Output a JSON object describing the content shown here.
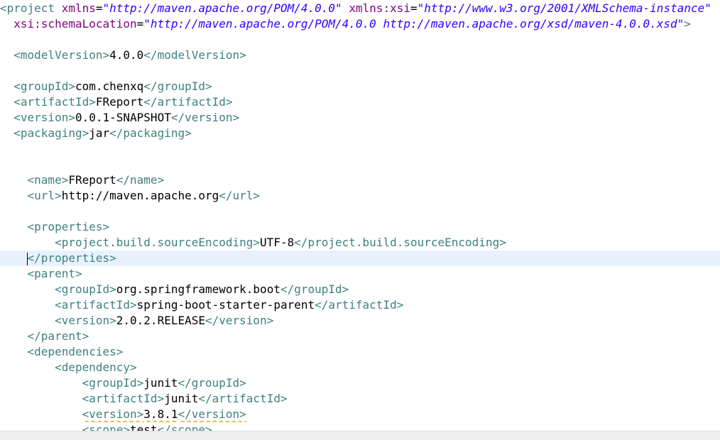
{
  "editor": {
    "lines": [
      {
        "segments": [
          {
            "t": "tag",
            "s": "<project"
          },
          {
            "t": "text",
            "s": " "
          },
          {
            "t": "attr",
            "s": "xmlns"
          },
          {
            "t": "text",
            "s": "="
          },
          {
            "t": "val",
            "s": "\"http://maven.apache.org/POM/4.0.0\""
          },
          {
            "t": "text",
            "s": " "
          },
          {
            "t": "attr",
            "s": "xmlns:xsi"
          },
          {
            "t": "text",
            "s": "="
          },
          {
            "t": "val",
            "s": "\"http://www.w3.org/2001/XMLSchema-instance\""
          }
        ]
      },
      {
        "segments": [
          {
            "t": "text",
            "s": "  "
          },
          {
            "t": "attr",
            "s": "xsi:schemaLocation"
          },
          {
            "t": "text",
            "s": "="
          },
          {
            "t": "val",
            "s": "\"http://maven.apache.org/POM/4.0.0 http://maven.apache.org/xsd/maven-4.0.0.xsd\""
          },
          {
            "t": "tag",
            "s": ">"
          }
        ]
      },
      {
        "segments": []
      },
      {
        "segments": [
          {
            "t": "text",
            "s": "  "
          },
          {
            "t": "tag",
            "s": "<modelVersion>"
          },
          {
            "t": "text",
            "s": "4.0.0"
          },
          {
            "t": "tag",
            "s": "</modelVersion>"
          }
        ]
      },
      {
        "segments": []
      },
      {
        "segments": [
          {
            "t": "text",
            "s": "  "
          },
          {
            "t": "tag",
            "s": "<groupId>"
          },
          {
            "t": "text",
            "s": "com.chenxq"
          },
          {
            "t": "tag",
            "s": "</groupId>"
          }
        ]
      },
      {
        "segments": [
          {
            "t": "text",
            "s": "  "
          },
          {
            "t": "tag",
            "s": "<artifactId>"
          },
          {
            "t": "text",
            "s": "FReport"
          },
          {
            "t": "tag",
            "s": "</artifactId>"
          }
        ]
      },
      {
        "segments": [
          {
            "t": "text",
            "s": "  "
          },
          {
            "t": "tag",
            "s": "<version>"
          },
          {
            "t": "text",
            "s": "0.0.1-SNAPSHOT"
          },
          {
            "t": "tag",
            "s": "</version>"
          }
        ]
      },
      {
        "segments": [
          {
            "t": "text",
            "s": "  "
          },
          {
            "t": "tag",
            "s": "<packaging>"
          },
          {
            "t": "text",
            "s": "jar"
          },
          {
            "t": "tag",
            "s": "</packaging>"
          }
        ]
      },
      {
        "segments": []
      },
      {
        "segments": []
      },
      {
        "segments": [
          {
            "t": "text",
            "s": "    "
          },
          {
            "t": "tag",
            "s": "<name>"
          },
          {
            "t": "text",
            "s": "FReport"
          },
          {
            "t": "tag",
            "s": "</name>"
          }
        ]
      },
      {
        "segments": [
          {
            "t": "text",
            "s": "    "
          },
          {
            "t": "tag",
            "s": "<url>"
          },
          {
            "t": "text",
            "s": "http://maven.apache.org"
          },
          {
            "t": "tag",
            "s": "</url>"
          }
        ]
      },
      {
        "segments": []
      },
      {
        "segments": [
          {
            "t": "text",
            "s": "    "
          },
          {
            "t": "tag",
            "s": "<properties>"
          }
        ]
      },
      {
        "segments": [
          {
            "t": "text",
            "s": "        "
          },
          {
            "t": "tag",
            "s": "<project.build.sourceEncoding>"
          },
          {
            "t": "text",
            "s": "UTF-8"
          },
          {
            "t": "tag",
            "s": "</project.build.sourceEncoding>"
          }
        ]
      },
      {
        "current": true,
        "caret_before": 1,
        "segments": [
          {
            "t": "text",
            "s": "    "
          },
          {
            "t": "tag",
            "s": "</properties>"
          }
        ]
      },
      {
        "segments": [
          {
            "t": "text",
            "s": "    "
          },
          {
            "t": "tag",
            "s": "<parent>"
          }
        ]
      },
      {
        "segments": [
          {
            "t": "text",
            "s": "        "
          },
          {
            "t": "tag",
            "s": "<groupId>"
          },
          {
            "t": "text",
            "s": "org.springframework.boot"
          },
          {
            "t": "tag",
            "s": "</groupId>"
          }
        ]
      },
      {
        "segments": [
          {
            "t": "text",
            "s": "        "
          },
          {
            "t": "tag",
            "s": "<artifactId>"
          },
          {
            "t": "text",
            "s": "spring-boot-starter-parent"
          },
          {
            "t": "tag",
            "s": "</artifactId>"
          }
        ]
      },
      {
        "segments": [
          {
            "t": "text",
            "s": "        "
          },
          {
            "t": "tag",
            "s": "<version>"
          },
          {
            "t": "text",
            "s": "2.0.2.RELEASE"
          },
          {
            "t": "tag",
            "s": "</version>"
          }
        ]
      },
      {
        "segments": [
          {
            "t": "text",
            "s": "    "
          },
          {
            "t": "tag",
            "s": "</parent>"
          }
        ]
      },
      {
        "segments": [
          {
            "t": "text",
            "s": "    "
          },
          {
            "t": "tag",
            "s": "<dependencies>"
          }
        ]
      },
      {
        "segments": [
          {
            "t": "text",
            "s": "        "
          },
          {
            "t": "tag",
            "s": "<dependency>"
          }
        ]
      },
      {
        "segments": [
          {
            "t": "text",
            "s": "            "
          },
          {
            "t": "tag",
            "s": "<groupId>"
          },
          {
            "t": "text",
            "s": "junit"
          },
          {
            "t": "tag",
            "s": "</groupId>"
          }
        ]
      },
      {
        "segments": [
          {
            "t": "text",
            "s": "            "
          },
          {
            "t": "tag",
            "s": "<artifactId>"
          },
          {
            "t": "text",
            "s": "junit"
          },
          {
            "t": "tag",
            "s": "</artifactId>"
          }
        ]
      },
      {
        "segments": [
          {
            "t": "text",
            "s": "            "
          },
          {
            "t": "tag",
            "s": "<version>",
            "warn": true
          },
          {
            "t": "text",
            "s": "3.8.1",
            "warn": true
          },
          {
            "t": "tag",
            "s": "</version>",
            "warn": true
          }
        ]
      },
      {
        "segments": [
          {
            "t": "text",
            "s": "            "
          },
          {
            "t": "tag",
            "s": "<scope>"
          },
          {
            "t": "text",
            "s": "test"
          },
          {
            "t": "tag",
            "s": "</scope>"
          }
        ]
      }
    ]
  },
  "colors": {
    "tag": "#3f7f7f",
    "attribute": "#7f007f",
    "attribute_value": "#2a00ff",
    "text": "#000000",
    "current_line": "#e8f2fe",
    "warning_underline": "#e0b020"
  }
}
